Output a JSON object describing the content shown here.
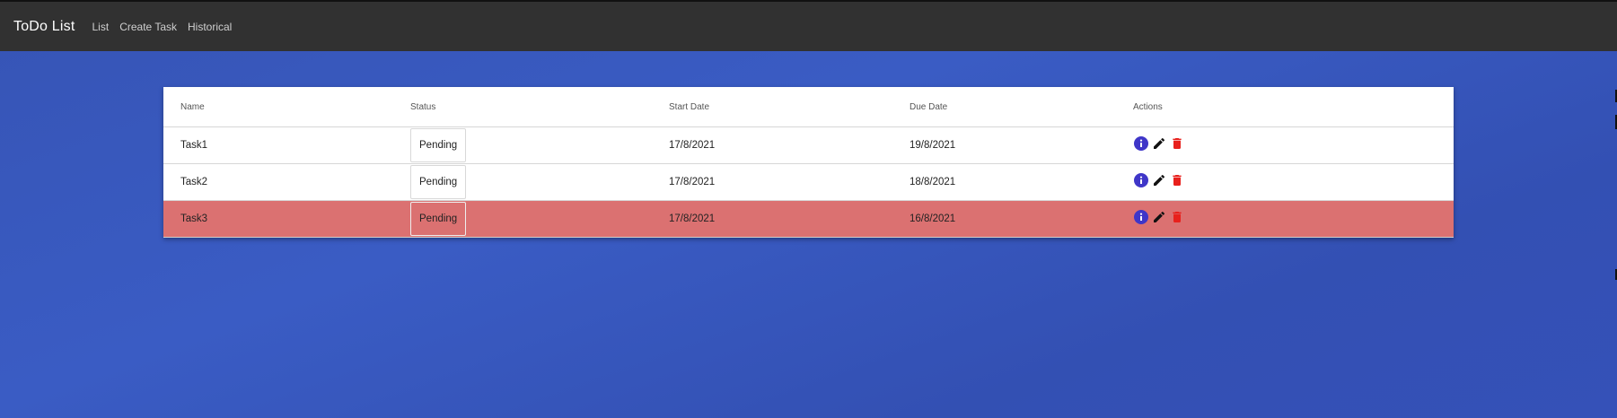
{
  "app": {
    "title": "ToDo List"
  },
  "nav": {
    "items": [
      {
        "label": "List"
      },
      {
        "label": "Create Task"
      },
      {
        "label": "Historical"
      }
    ]
  },
  "table": {
    "columns": [
      "Name",
      "Status",
      "Start Date",
      "Due Date",
      "Actions"
    ],
    "rows": [
      {
        "name": "Task1",
        "status": "Pending",
        "start_date": "17/8/2021",
        "due_date": "19/8/2021",
        "overdue": false
      },
      {
        "name": "Task2",
        "status": "Pending",
        "start_date": "17/8/2021",
        "due_date": "18/8/2021",
        "overdue": false
      },
      {
        "name": "Task3",
        "status": "Pending",
        "start_date": "17/8/2021",
        "due_date": "16/8/2021",
        "overdue": true
      }
    ],
    "action_icons": [
      "info-icon",
      "edit-icon",
      "delete-icon"
    ]
  },
  "colors": {
    "topbar": "#313131",
    "background": "#3654b5",
    "overdue_row": "#db7171",
    "info_icon": "#3f36c8",
    "edit_icon": "#111111",
    "delete_icon": "#e8201c"
  }
}
